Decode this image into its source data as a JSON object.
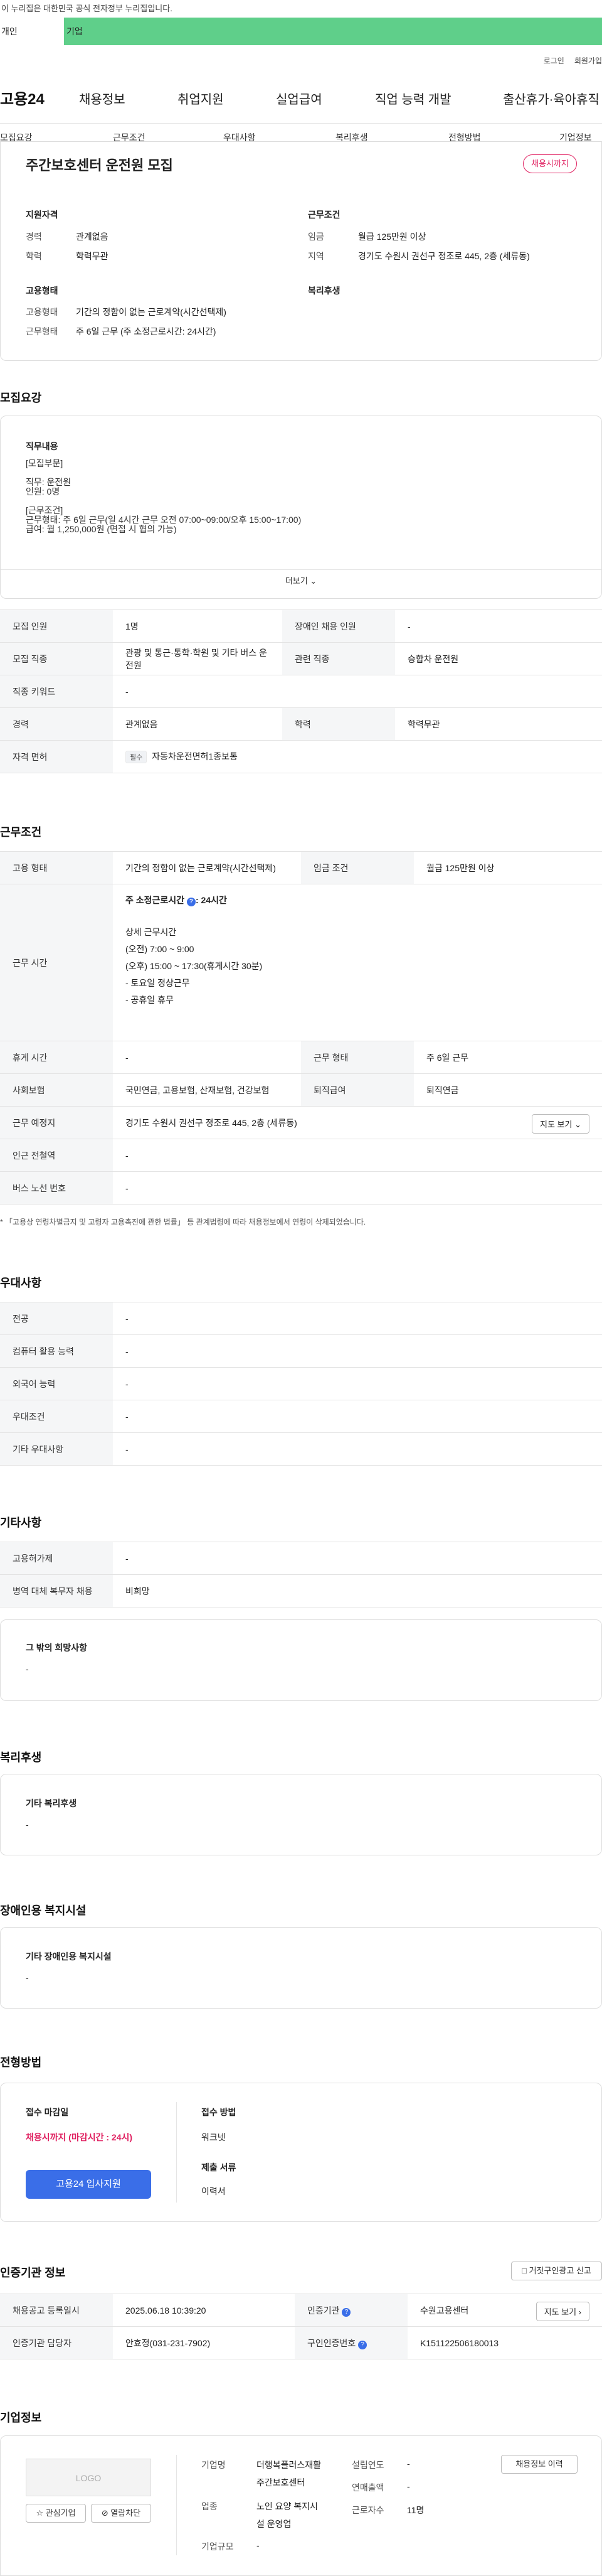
{
  "gov_banner": "이 누리집은 대한민국 공식 전자정부 누리집입니다.",
  "audience_tabs": {
    "individual": "개인",
    "business": "기업"
  },
  "util": {
    "login": "로그인",
    "join": "회원가입"
  },
  "gnb": {
    "logo": "고용24",
    "menu": [
      "채용정보",
      "취업지원",
      "실업급여",
      "직업 능력 개발",
      "출산휴가·육아휴직"
    ]
  },
  "subnav": [
    "모집요강",
    "근무조건",
    "우대사항",
    "복리후생",
    "전형방법",
    "기업정보"
  ],
  "summary": {
    "title": "주간보호센터 운전원 모집",
    "deadline_badge": "채용시까지",
    "qual_h": "지원자격",
    "exp_l": "경력",
    "exp_v": "관계없음",
    "edu_l": "학력",
    "edu_v": "학력무관",
    "cond_h": "근무조건",
    "wage_l": "임금",
    "wage_v": "월급 125만원 이상",
    "loc_l": "지역",
    "loc_v": "경기도 수원시 권선구 정조로 445, 2층 (세류동)",
    "emp_h": "고용형태",
    "emptype_l": "고용형태",
    "emptype_v": "기간의 정함이 없는 근로계약(시간선택제)",
    "worktype_l": "근무형태",
    "worktype_v": "주 6일 근무 (주 소정근로시간: 24시간)",
    "welfare_h": "복리후생"
  },
  "recruit": {
    "heading": "모집요강",
    "desc_title": "직무내용",
    "desc_lines": [
      "[모집부문]",
      "",
      "직무: 운전원",
      "인원: 0명",
      "",
      "[근무조건]",
      "근무형태: 주 6일 근무(일 4시간 근무 오전 07:00~09:00/오후 15:00~17:00)",
      "급여: 월 1,250,000원 (면접 시 협의 가능)"
    ],
    "more": "더보기",
    "rows": [
      {
        "l1": "모집 인원",
        "v1": "1명",
        "l2": "장애인 채용 인원",
        "v2": "-"
      },
      {
        "l1": "모집 직종",
        "v1": "관광 및 통근·통학·학원 및 기타 버스 운전원",
        "l2": "관련 직종",
        "v2": "승합차 운전원"
      },
      {
        "l1": "직종 키워드",
        "v1": "-"
      },
      {
        "l1": "경력",
        "v1": "관계없음",
        "l2": "학력",
        "v2": "학력무관"
      },
      {
        "l1": "자격 면허",
        "pill": "필수",
        "v1": "자동차운전면허1종보통"
      }
    ]
  },
  "conditions": {
    "heading": "근무조건",
    "emp_l": "고용 형태",
    "emp_v": "기간의 정함이 없는 근로계약(시간선택제)",
    "wage_l": "임금 조건",
    "wage_v": "월급 125만원 이상",
    "hours_l": "근무 시간",
    "hours_week": "주 소정근로시간",
    "hours_week_v": ": 24시간",
    "hours_detail_h": "상세 근무시간",
    "hours_lines": [
      "(오전) 7:00 ~ 9:00",
      "(오후) 15:00 ~ 17:30(휴게시간 30분)",
      "- 토요일 정상근무",
      "- 공휴일 휴무"
    ],
    "break_l": "휴게 시간",
    "break_v": "-",
    "shift_l": "근무 형태",
    "shift_v": "주 6일 근무",
    "ins_l": "사회보험",
    "ins_v": "국민연금, 고용보험, 산재보험, 건강보험",
    "ret_l": "퇴직급여",
    "ret_v": "퇴직연금",
    "place_l": "근무 예정지",
    "place_v": "경기도 수원시 권선구 정조로 445, 2층 (세류동)",
    "map_btn": "지도 보기",
    "station_l": "인근 전철역",
    "station_v": "-",
    "bus_l": "버스 노선 번호",
    "bus_v": "-",
    "note": "* 「고용상 연령차별금지 및 고령자 고용촉진에 관한 법률」 등 관계법령에 따라 채용정보에서 연령이 삭제되었습니다."
  },
  "preference": {
    "heading": "우대사항",
    "rows": [
      {
        "l": "전공",
        "v": "-"
      },
      {
        "l": "컴퓨터 활용 능력",
        "v": "-"
      },
      {
        "l": "외국어 능력",
        "v": "-"
      },
      {
        "l": "우대조건",
        "v": "-"
      },
      {
        "l": "기타 우대사항",
        "v": "-"
      }
    ]
  },
  "etc": {
    "heading": "기타사항",
    "rows": [
      {
        "l": "고용허가제",
        "v": "-"
      },
      {
        "l": "병역 대체 복무자 채용",
        "v": "비희망"
      }
    ],
    "other_h": "그 밖의 희망사항",
    "other_v": "-"
  },
  "welfare": {
    "heading": "복리후생",
    "box_h": "기타 복리후생",
    "box_v": "-"
  },
  "disabled": {
    "heading": "장애인용 복지시설",
    "box_h": "기타 장애인용 복지시설",
    "box_v": "-"
  },
  "process": {
    "heading": "전형방법",
    "deadline_h": "접수 마감일",
    "deadline_v": "채용시까지 (마감시간 : 24시)",
    "apply_btn": "고용24 입사지원",
    "method_h": "접수 방법",
    "method_v": "워크넷",
    "docs_h": "제출 서류",
    "docs_v": "이력서"
  },
  "agency": {
    "heading": "인증기관 정보",
    "report_btn": "거짓구인광고 신고",
    "reg_l": "채용공고 등록일시",
    "reg_v": "2025.06.18 10:39:20",
    "org_l": "인증기관",
    "org_v": "수원고용센터",
    "map_btn": "지도 보기",
    "mgr_l": "인증기관 담당자",
    "mgr_v": "안효정(031-231-7902)",
    "id_l": "구인인증번호",
    "id_v": "K151122506180013"
  },
  "company": {
    "heading": "기업정보",
    "logo": "LOGO",
    "fav_btn": "관심기업",
    "block_btn": "열람차단",
    "name_l": "기업명",
    "name_v1": "더행복플러스재활",
    "name_v2": "주간보호센터",
    "biz_l": "업종",
    "biz_v1": "노인 요양 복지시",
    "biz_v2": "설 운영업",
    "size_l": "기업규모",
    "size_v": "-",
    "est_l": "설립연도",
    "est_v": "-",
    "rev_l": "연매출액",
    "rev_v": "-",
    "emp_l": "근로자수",
    "emp_v": "11명",
    "more_btn": "채용정보 이력"
  },
  "colors": {
    "brand_green": "#5fcf8a",
    "accent_red": "#e02060",
    "accent_blue": "#3a6ee8"
  }
}
